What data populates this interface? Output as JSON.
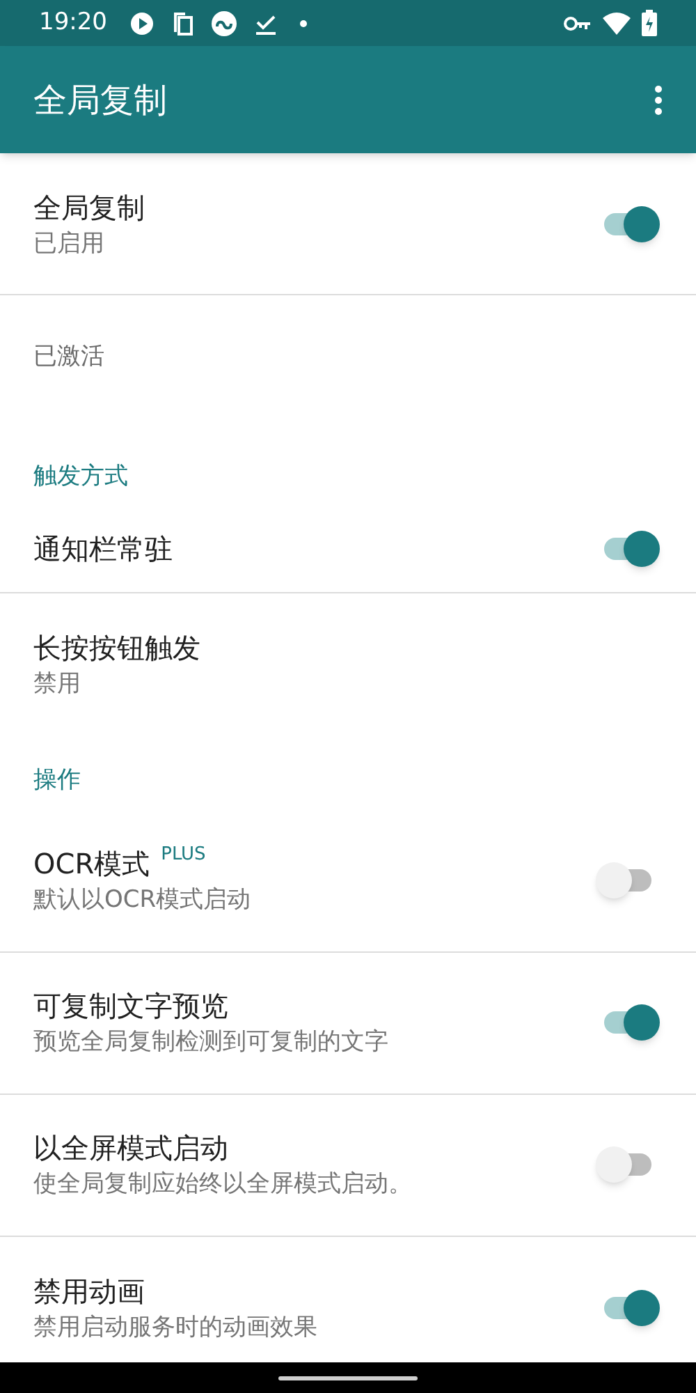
{
  "status_bar": {
    "time": "19:20"
  },
  "app_bar": {
    "title": "全局复制"
  },
  "items": [
    {
      "kind": "switch",
      "title": "全局复制",
      "summary": "已启用",
      "on": true
    },
    {
      "kind": "info",
      "title": "已激活"
    },
    {
      "kind": "category",
      "title": "触发方式"
    },
    {
      "kind": "switch",
      "title": "通知栏常驻",
      "on": true
    },
    {
      "kind": "plain",
      "title": "长按按钮触发",
      "summary": "禁用"
    },
    {
      "kind": "category",
      "title": "操作"
    },
    {
      "kind": "switch",
      "title": "OCR模式",
      "badge": "PLUS",
      "summary": "默认以OCR模式启动",
      "on": false
    },
    {
      "kind": "switch",
      "title": "可复制文字预览",
      "summary": "预览全局复制检测到可复制的文字",
      "on": true
    },
    {
      "kind": "switch",
      "title": "以全屏模式启动",
      "summary": "使全局复制应始终以全屏模式启动。",
      "on": false
    },
    {
      "kind": "switch",
      "title": "禁用动画",
      "summary": "禁用启动服务时的动画效果",
      "on": true
    }
  ]
}
